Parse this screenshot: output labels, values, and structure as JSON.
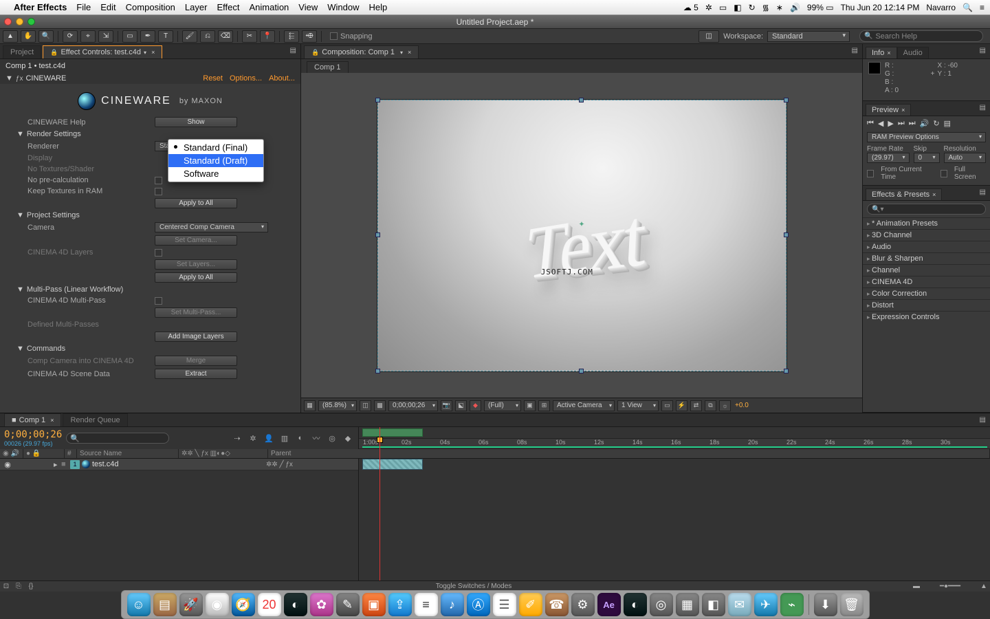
{
  "menubar": {
    "appname": "After Effects",
    "items": [
      "File",
      "Edit",
      "Composition",
      "Layer",
      "Effect",
      "Animation",
      "View",
      "Window",
      "Help"
    ],
    "cloud_count": "5",
    "battery": "99%",
    "datetime": "Thu Jun 20  12:14 PM",
    "user": "Navarro"
  },
  "window": {
    "title": "Untitled Project.aep *"
  },
  "toolbar": {
    "snapping": "Snapping",
    "workspace_label": "Workspace:",
    "workspace_value": "Standard",
    "search_placeholder": "Search Help"
  },
  "panels": {
    "project_tab": "Project",
    "effectcontrols_tab": "Effect Controls: test.c4d",
    "ec_crumb": "Comp 1 • test.c4d",
    "ec_effect": "CINEWARE",
    "ec_links": {
      "reset": "Reset",
      "options": "Options...",
      "about": "About..."
    },
    "cw_brand1": "CINEWARE",
    "cw_brand2": "by MAXON",
    "cw_help": "CINEWARE Help",
    "show_btn": "Show",
    "render_settings": "Render Settings",
    "renderer": "Renderer",
    "renderer_value": "Standard (Final)",
    "renderer_options": [
      "Standard (Final)",
      "Standard (Draft)",
      "Software"
    ],
    "display": "Display",
    "no_tex": "No Textures/Shader",
    "no_pre": "No pre-calculation",
    "keep_tex": "Keep Textures in RAM",
    "apply_all": "Apply to All",
    "project_settings": "Project Settings",
    "camera": "Camera",
    "camera_value": "Centered Comp Camera",
    "set_camera": "Set Camera...",
    "c4d_layers": "CINEMA 4D Layers",
    "set_layers": "Set Layers...",
    "multipass": "Multi-Pass (Linear Workflow)",
    "c4d_mp": "CINEMA 4D Multi-Pass",
    "set_mp": "Set Multi-Pass...",
    "defined_mp": "Defined Multi-Passes",
    "add_img": "Add Image Layers",
    "commands": "Commands",
    "comp_cam": "Comp Camera into CINEMA 4D",
    "merge": "Merge",
    "scene_data": "CINEMA 4D Scene Data",
    "extract": "Extract"
  },
  "comp": {
    "tab": "Composition: Comp 1",
    "subtab": "Comp 1",
    "text3d": "Text",
    "watermark": "JSOFTJ.COM",
    "zoom": "(85.8%)",
    "timecode": "0;00;00;26",
    "res": "(Full)",
    "cam": "Active Camera",
    "view": "1 View",
    "exposure": "+0.0"
  },
  "info": {
    "tab": "Info",
    "audio_tab": "Audio",
    "r": "R :",
    "g": "G :",
    "b": "B :",
    "a": "A :  0",
    "x": "X : -60",
    "y": "Y : 1"
  },
  "preview": {
    "tab": "Preview",
    "ram_opts": "RAM Preview Options",
    "fr_label": "Frame Rate",
    "fr_val": "(29.97)",
    "skip_label": "Skip",
    "skip_val": "0",
    "res_label": "Resolution",
    "res_val": "Auto",
    "from_current": "From Current Time",
    "full_screen": "Full Screen"
  },
  "effects_presets": {
    "tab": "Effects & Presets",
    "items": [
      "* Animation Presets",
      "3D Channel",
      "Audio",
      "Blur & Sharpen",
      "Channel",
      "CINEMA 4D",
      "Color Correction",
      "Distort",
      "Expression Controls"
    ]
  },
  "timeline": {
    "tab": "Comp 1",
    "rq_tab": "Render Queue",
    "timecode": "0;00;00;26",
    "frames": "00026 (29.97 fps)",
    "cols": {
      "num": "#",
      "source": "Source Name",
      "parent": "Parent"
    },
    "layer": {
      "num": "1",
      "name": "test.c4d"
    },
    "ticks": [
      "1:00s",
      "02s",
      "04s",
      "06s",
      "08s",
      "10s",
      "12s",
      "14s",
      "16s",
      "18s",
      "20s",
      "22s",
      "24s",
      "26s",
      "28s",
      "30s"
    ],
    "toggle": "Toggle Switches / Modes"
  },
  "dock": {
    "ae": "Ae"
  }
}
